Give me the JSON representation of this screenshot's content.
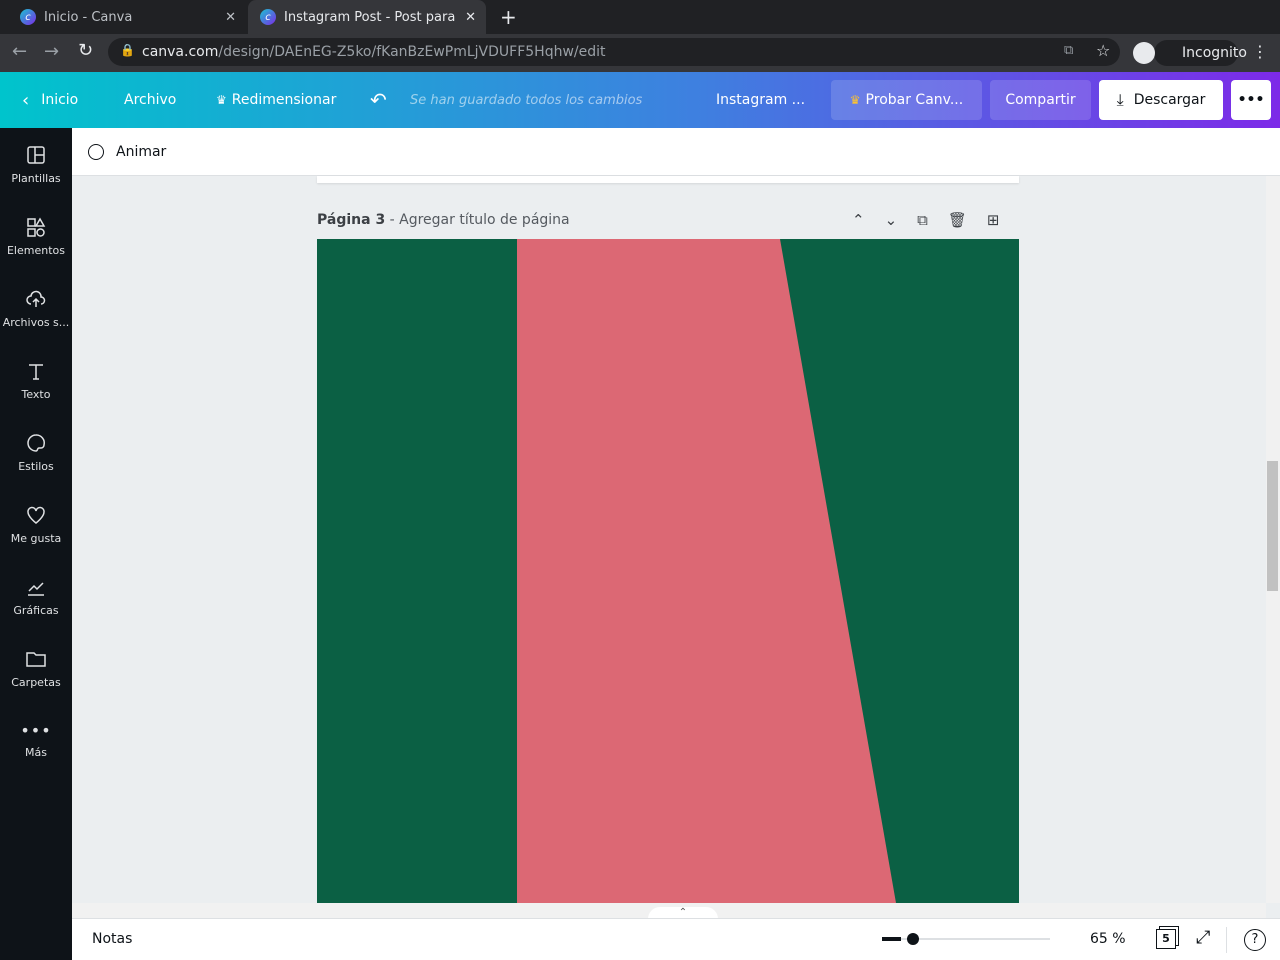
{
  "browser": {
    "tabs": [
      {
        "title": "Inicio - Canva"
      },
      {
        "title": "Instagram Post - Post para"
      }
    ],
    "url_host": "canva.com",
    "url_path": "/design/DAEnEG-Z5ko/fKanBzEwPmLjVDUFF5Hqhw/edit",
    "profile": "Incognito"
  },
  "header": {
    "home": "Inicio",
    "file": "Archivo",
    "resize": "Redimensionar",
    "saved_status": "Se han guardado todos los cambios",
    "design_name": "Instagram ...",
    "try_pro": "Probar Canv...",
    "share": "Compartir",
    "download": "Descargar"
  },
  "sidebar": {
    "items": [
      {
        "label": "Plantillas"
      },
      {
        "label": "Elementos"
      },
      {
        "label": "Archivos s..."
      },
      {
        "label": "Texto"
      },
      {
        "label": "Estilos"
      },
      {
        "label": "Me gusta"
      },
      {
        "label": "Gráficas"
      },
      {
        "label": "Carpetas"
      },
      {
        "label": "Más"
      }
    ]
  },
  "toolbar": {
    "animate": "Animar"
  },
  "page": {
    "number_label": "Página 3",
    "title_placeholder": "- Agregar título de página"
  },
  "colors": {
    "green": "#0b6044",
    "pink": "#dc6874"
  },
  "footer": {
    "notes": "Notas",
    "zoom": "65 %",
    "zoom_percent": 65,
    "page_count": "5"
  }
}
